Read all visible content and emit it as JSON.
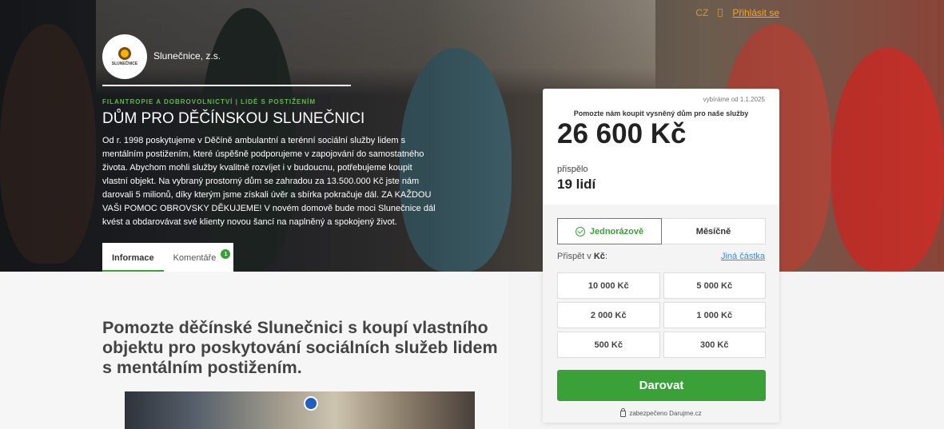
{
  "nav": {
    "lang": "CZ",
    "login": "Přihlásit se"
  },
  "org": {
    "name": "Slunečnice, z.s.",
    "logo_text": "SLUNEČNICE"
  },
  "hero": {
    "categories": "FILANTROPIE A DOBROVOLNICTVÍ | LIDÉ S POSTIŽENÍM",
    "title": "DŮM PRO DĚČÍNSKOU SLUNEČNICI",
    "description": "Od r. 1998 poskytujeme v Děčíně ambulantní a terénní sociální služby lidem s mentálním postižením, které úspěšně podporujeme v zapojování do samostatného života. Abychom mohli služby kvalitně rozvíjet i v budoucnu, potřebujeme koupit vlastní objekt. Na vybraný prostorný dům se zahradou za 13.500.000 Kč jste nám darovali 5 milionů, díky kterým jsme získali úvěr a sbírka pokračuje dál. ZA KAŽDOU VAŠI POMOC OBROVSKY DĚKUJEME! V novém domově bude moci Slunečnice dál kvést a obdarovávat své klienty novou šancí na naplněný a spokojený život."
  },
  "tabs": [
    {
      "label": "Informace",
      "active": true
    },
    {
      "label": "Komentáře",
      "badge": "1"
    }
  ],
  "content": {
    "heading": "Pomozte děčínské Slunečnici s koupí vlastního objektu pro poskytování sociálních služeb lidem s mentálním postižením."
  },
  "card": {
    "since": "vybíráme od 1.1.2025",
    "goal_text": "Pomozte nám koupit vysněný dům pro naše služby",
    "amount": "26 600 Kč",
    "contributed_label": "přispělo",
    "contributed_value": "19 lidí",
    "freq_once": "Jednorázově",
    "freq_monthly": "Měsíčně",
    "contribute_in": "Přispět v",
    "currency": "Kč",
    "other_amount": "Jiná částka",
    "amounts": [
      "10 000 Kč",
      "5 000 Kč",
      "2 000 Kč",
      "1 000 Kč",
      "500 Kč",
      "300 Kč"
    ],
    "donate": "Darovat",
    "secure": "zabezpečeno Darujme.cz"
  },
  "colors": {
    "accent": "#3aa138",
    "link": "#3b8be0",
    "nav": "#f0a626"
  }
}
